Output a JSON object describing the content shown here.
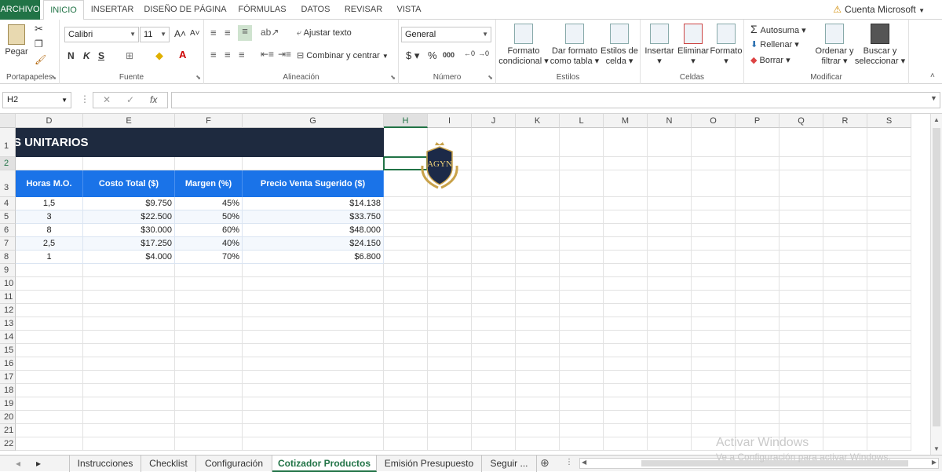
{
  "ribbon_tabs": {
    "file": "ARCHIVO",
    "home": "INICIO",
    "insert": "INSERTAR",
    "page_layout": "DISEÑO DE PÁGINA",
    "formulas": "FÓRMULAS",
    "data": "DATOS",
    "review": "REVISAR",
    "view": "VISTA"
  },
  "account": "Cuenta Microsoft",
  "ribbon": {
    "paste": "Pegar",
    "clipboard_group": "Portapapeles",
    "font_name": "Calibri",
    "font_size": "11",
    "font_group": "Fuente",
    "bold": "N",
    "italic": "K",
    "underline": "S",
    "wrap_text": "Ajustar texto",
    "merge_center": "Combinar y centrar",
    "alignment_group": "Alineación",
    "number_format": "General",
    "number_group": "Número",
    "conditional_format": [
      "Formato",
      "condicional"
    ],
    "format_table": [
      "Dar formato",
      "como tabla"
    ],
    "cell_styles": [
      "Estilos de",
      "celda"
    ],
    "styles_group": "Estilos",
    "insert": "Insertar",
    "delete": "Eliminar",
    "format": "Formato",
    "cells_group": "Celdas",
    "autosum": "Autosuma",
    "fill": "Rellenar",
    "clear": "Borrar",
    "sort_filter": [
      "Ordenar y",
      "filtrar"
    ],
    "find_select": [
      "Buscar y",
      "seleccionar"
    ],
    "modify_group": "Modificar"
  },
  "formula_bar": {
    "name_box": "H2",
    "fx": "fx",
    "value": ""
  },
  "columns": [
    "D",
    "E",
    "F",
    "G",
    "H",
    "I",
    "J",
    "K",
    "L",
    "M",
    "N",
    "O",
    "P",
    "Q",
    "R",
    "S"
  ],
  "rows": [
    "1",
    "2",
    "3",
    "4",
    "5",
    "6",
    "7",
    "8",
    "9",
    "10",
    "11",
    "12",
    "13",
    "14",
    "15",
    "16",
    "17",
    "18",
    "19",
    "20",
    "21",
    "22"
  ],
  "sheet": {
    "title": "S UNITARIOS",
    "headers": [
      "Horas M.O.",
      "Costo Total ($)",
      "Margen (%)",
      "Precio Venta Sugerido ($)"
    ],
    "data": [
      [
        "1,5",
        "$9.750",
        "45%",
        "$14.138"
      ],
      [
        "3",
        "$22.500",
        "50%",
        "$33.750"
      ],
      [
        "8",
        "$30.000",
        "60%",
        "$48.000"
      ],
      [
        "2,5",
        "$17.250",
        "40%",
        "$24.150"
      ],
      [
        "1",
        "$4.000",
        "70%",
        "$6.800"
      ]
    ],
    "logo_text": "AGYN"
  },
  "sheet_tabs": [
    "Instrucciones",
    "Checklist",
    "Configuración",
    "Cotizador Productos",
    "Emisión Presupuesto",
    "Seguir ..."
  ],
  "active_sheet": "Cotizador Productos",
  "watermark": {
    "line1": "Activar Windows",
    "line2": "Ve a Configuración para activar Windows."
  },
  "colors": {
    "excel_green": "#217346",
    "title_navy": "#1e2a3f",
    "header_blue": "#1a73e8"
  }
}
